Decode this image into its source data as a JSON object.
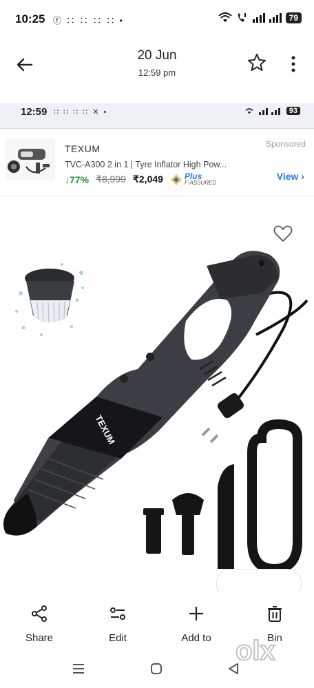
{
  "status_bar": {
    "time": "10:25",
    "notifications": "ⓕ ∷ ∷ ∷ ∷ •",
    "battery": "79"
  },
  "header": {
    "date": "20 Jun",
    "time": "12:59 pm",
    "back_icon": "arrow-left-icon",
    "favorite_icon": "star-outline-icon",
    "more_icon": "more-vert-icon"
  },
  "screenshot": {
    "status_bar": {
      "time": "12:59",
      "notifications": "∷ ∷ ∷ ∷ ✕ •",
      "battery": "93"
    },
    "ad": {
      "brand": "TEXUM",
      "sponsored": "Sponsored",
      "title": "TVC-A300 2 in 1 | Tyre Inflator High Pow...",
      "discount": "↓77%",
      "mrp": "₹8,999",
      "price": "₹2,049",
      "plus_label": "Plus",
      "plus_sub": "F-ASSURED",
      "view_label": "View ›"
    },
    "product": {
      "brand_on_product": "TEXUM",
      "wishlist_icon": "heart-outline-icon"
    }
  },
  "actions": [
    {
      "label": "Share",
      "icon": "share-icon"
    },
    {
      "label": "Edit",
      "icon": "tune-icon"
    },
    {
      "label": "Add to",
      "icon": "plus-icon"
    },
    {
      "label": "Bin",
      "icon": "trash-icon"
    }
  ],
  "watermark": "olx"
}
